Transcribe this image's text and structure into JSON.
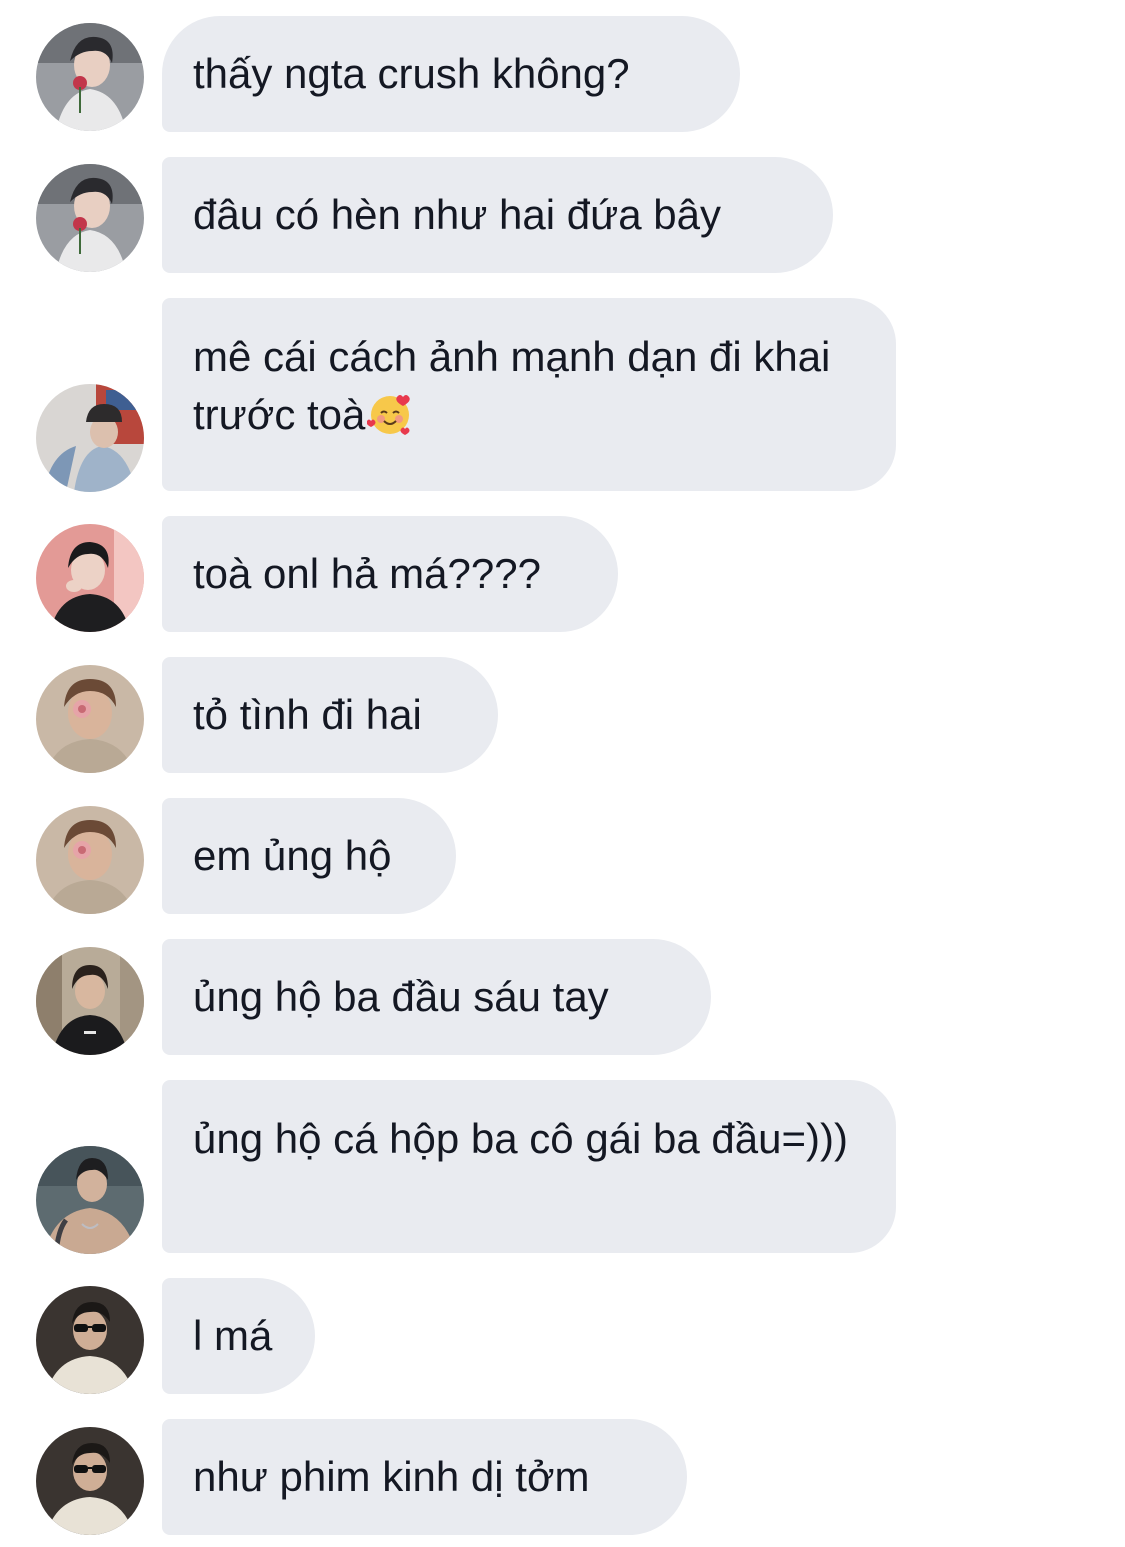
{
  "messages": [
    {
      "avatar": "avatar-boy-rose-icon",
      "text": "thấy ngta crush không?"
    },
    {
      "avatar": "avatar-boy-rose-icon",
      "text": "đâu có hèn như hai đứa bây"
    },
    {
      "avatar": "avatar-boy-cap-icon",
      "text": "mê cái cách ảnh mạnh dạn đi khai trước toà",
      "emoji": "smiling-face-with-hearts-icon"
    },
    {
      "avatar": "avatar-boy-pink-wall-icon",
      "text": "toà onl hả má????"
    },
    {
      "avatar": "avatar-boy-flower-face-icon",
      "text": "tỏ tình đi hai"
    },
    {
      "avatar": "avatar-boy-flower-face-icon",
      "text": "em ủng hộ"
    },
    {
      "avatar": "avatar-boy-black-shirt-icon",
      "text": "ủng hộ ba đầu sáu tay"
    },
    {
      "avatar": "avatar-boy-tattoo-icon",
      "text": "ủng hộ cá hộp ba cô gái ba đầu=)))"
    },
    {
      "avatar": "avatar-boy-sunglasses-icon",
      "text": "l má"
    },
    {
      "avatar": "avatar-boy-sunglasses-icon",
      "text": "như phim kinh dị tởm"
    }
  ],
  "colors": {
    "bubble": "#e9ebf0",
    "text": "#141823",
    "background": "#ffffff"
  }
}
